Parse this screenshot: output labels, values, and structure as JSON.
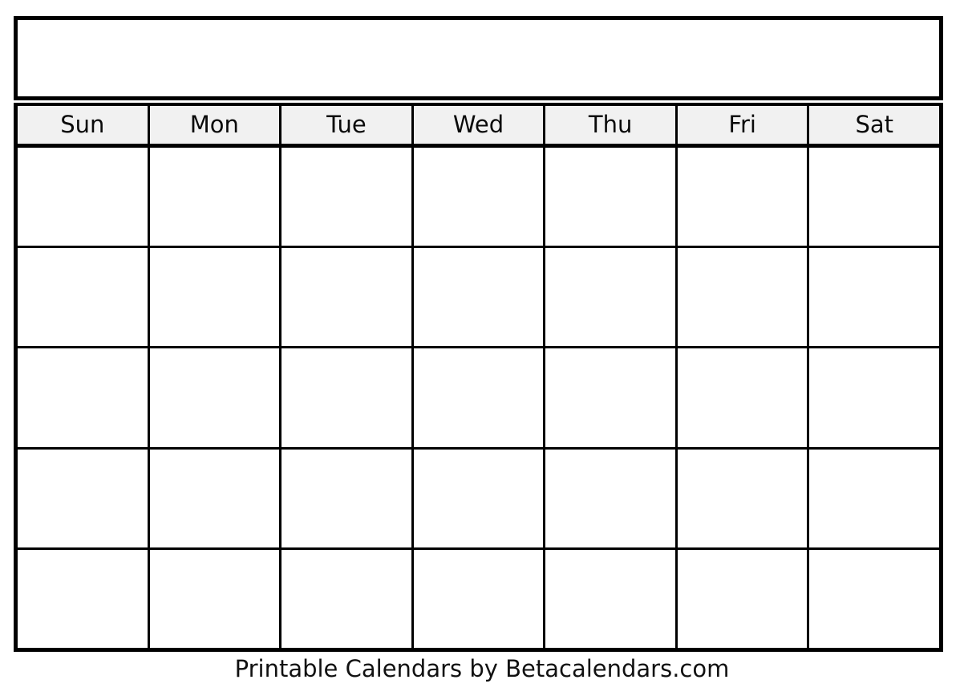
{
  "document": {
    "type": "blank-printable-calendar",
    "background_color": "#ffffff",
    "border_color": "#000000",
    "header_background_color": "#f1f1f1"
  },
  "calendar": {
    "title": "",
    "weekday_headers": [
      {
        "label": "Sun"
      },
      {
        "label": "Mon"
      },
      {
        "label": "Tue"
      },
      {
        "label": "Wed"
      },
      {
        "label": "Thu"
      },
      {
        "label": "Fri"
      },
      {
        "label": "Sat"
      }
    ],
    "weeks": [
      {
        "days": [
          "",
          "",
          "",
          "",
          "",
          "",
          ""
        ]
      },
      {
        "days": [
          "",
          "",
          "",
          "",
          "",
          "",
          ""
        ]
      },
      {
        "days": [
          "",
          "",
          "",
          "",
          "",
          "",
          ""
        ]
      },
      {
        "days": [
          "",
          "",
          "",
          "",
          "",
          "",
          ""
        ]
      },
      {
        "days": [
          "",
          "",
          "",
          "",
          "",
          "",
          ""
        ]
      }
    ]
  },
  "footer": {
    "credit": "Printable Calendars by Betacalendars.com"
  }
}
